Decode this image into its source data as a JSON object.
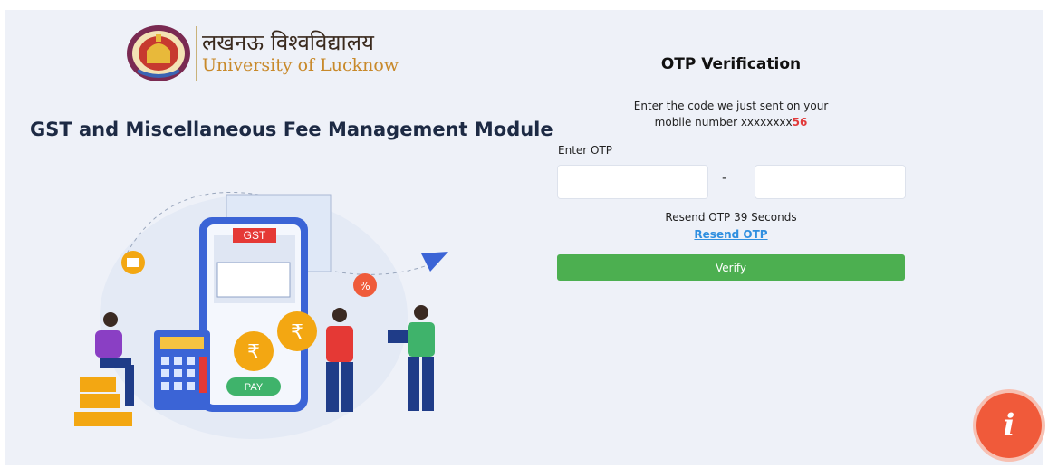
{
  "logo": {
    "hindi_name": "लखनऊ विश्वविद्यालय",
    "english_name": "University of Lucknow"
  },
  "module_title": "GST and Miscellaneous Fee Management Module",
  "illustration": {
    "gst_tag": "GST",
    "pay_label": "PAY",
    "rupee_symbol": "₹",
    "percent_symbol": "%"
  },
  "otp": {
    "title": "OTP Verification",
    "subtitle_line1": "Enter the code we just sent on your",
    "subtitle_line2_prefix": "mobile number xxxxxxxx",
    "subtitle_line2_suffix": "56",
    "enter_label": "Enter OTP",
    "separator": "-",
    "resend_timer": "Resend OTP 39 Seconds",
    "resend_link": "Resend OTP",
    "verify_label": "Verify"
  },
  "info_button": {
    "glyph": "i",
    "icon": "info-icon"
  },
  "colors": {
    "background": "#eef1f8",
    "verify": "#4caf50",
    "link": "#2f8fe0",
    "highlight": "#e23a3a",
    "info_fab": "#f05a3a"
  }
}
